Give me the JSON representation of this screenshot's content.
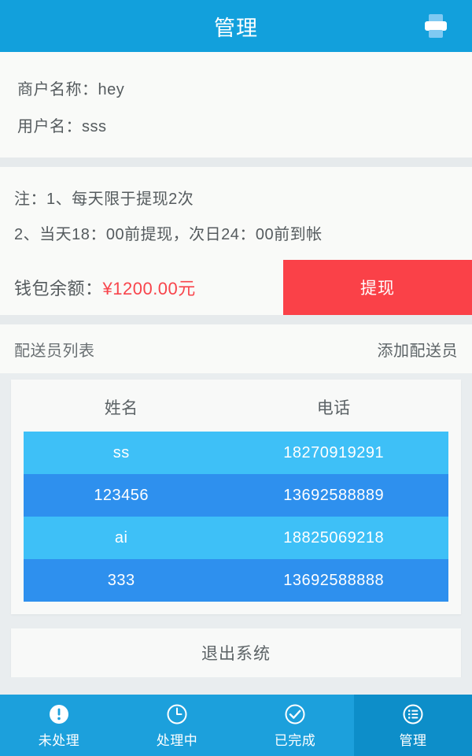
{
  "header": {
    "title": "管理",
    "print_icon": "printer-icon"
  },
  "account": {
    "merchant_label": "商户名称：hey",
    "username_label": "用户名：sss"
  },
  "notes": {
    "line1": "注：1、每天限于提现2次",
    "line2": "2、当天18：00前提现，次日24：00前到帐"
  },
  "balance": {
    "prefix": "钱包余额：",
    "amount": "¥1200.00元",
    "withdraw_label": "提现",
    "withdraw_color": "#FA4148",
    "amount_color": "#F8444B"
  },
  "courier_section": {
    "title": "配送员列表",
    "add_label": "添加配送员",
    "columns": [
      "姓名",
      "电话"
    ],
    "rows": [
      {
        "name": "ss",
        "phone": "18270919291"
      },
      {
        "name": "123456",
        "phone": "13692588889"
      },
      {
        "name": "ai",
        "phone": "18825069218"
      },
      {
        "name": "333",
        "phone": "13692588888"
      }
    ],
    "row_colors": {
      "light": "#3EC0F7",
      "dark": "#2E90EE"
    }
  },
  "logout": {
    "label": "退出系统"
  },
  "tabbar": {
    "active_index": 3,
    "active_color": "#0D8EC9",
    "base_color": "#1CA0DC",
    "items": [
      {
        "label": "未处理",
        "icon": "exclamation-circle-icon"
      },
      {
        "label": "处理中",
        "icon": "clock-circle-icon"
      },
      {
        "label": "已完成",
        "icon": "check-circle-icon"
      },
      {
        "label": "管理",
        "icon": "list-circle-icon"
      }
    ]
  }
}
